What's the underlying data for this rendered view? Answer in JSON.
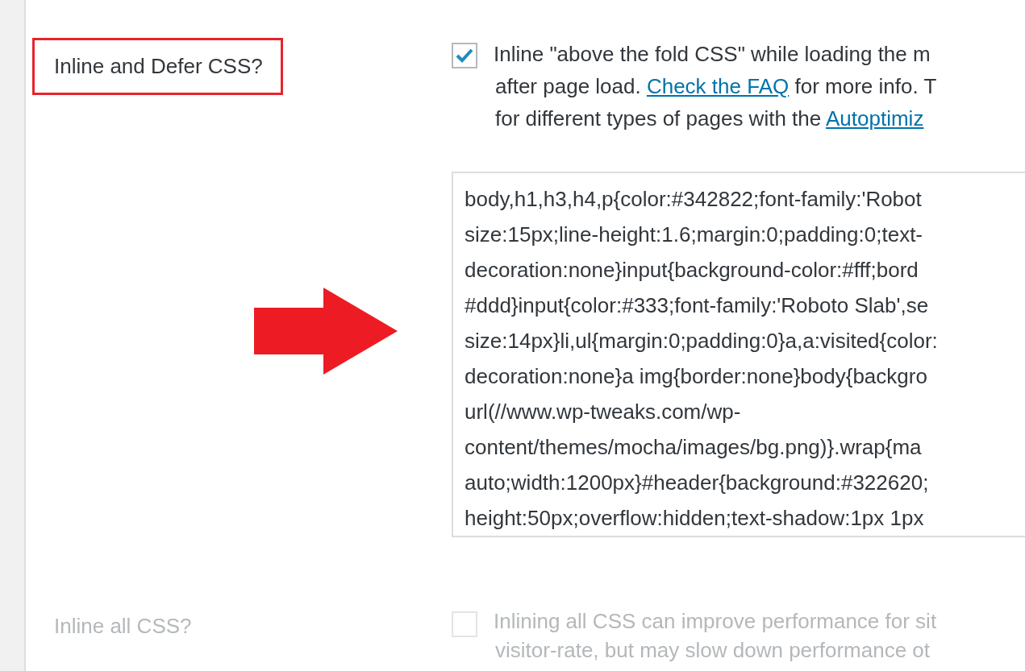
{
  "settings": [
    {
      "label": "Inline and Defer CSS?",
      "highlighted": true,
      "checked": true,
      "disabled": false,
      "description": [
        [
          {
            "text": "Inline \"above the fold CSS\" while loading the m"
          }
        ],
        [
          {
            "text": "after page load. "
          },
          {
            "text": "Check the FAQ",
            "kind": "link"
          },
          {
            "text": " for more info. T"
          }
        ],
        [
          {
            "text": "for different types of pages with the "
          },
          {
            "text": "Autoptimiz",
            "kind": "link"
          }
        ]
      ],
      "css_field": {
        "value": [
          "body,h1,h3,h4,p{color:#342822;font-family:'Robot",
          "size:15px;line-height:1.6;margin:0;padding:0;text-",
          "decoration:none}input{background-color:#fff;bord",
          "#ddd}input{color:#333;font-family:'Roboto Slab',se",
          "size:14px}li,ul{margin:0;padding:0}a,a:visited{color:",
          "decoration:none}a img{border:none}body{backgro",
          "url(//www.wp-tweaks.com/wp-",
          "content/themes/mocha/images/bg.png)}.wrap{ma",
          "auto;width:1200px}#header{background:#322620;",
          "height:50px;overflow:hidden;text-shadow:1px 1px"
        ]
      }
    },
    {
      "label": "Inline all CSS?",
      "highlighted": false,
      "checked": false,
      "disabled": true,
      "description": [
        [
          {
            "text": "Inlining all CSS can improve performance for sit"
          }
        ],
        [
          {
            "text": "visitor-rate, but may slow down performance ot"
          }
        ]
      ]
    }
  ]
}
